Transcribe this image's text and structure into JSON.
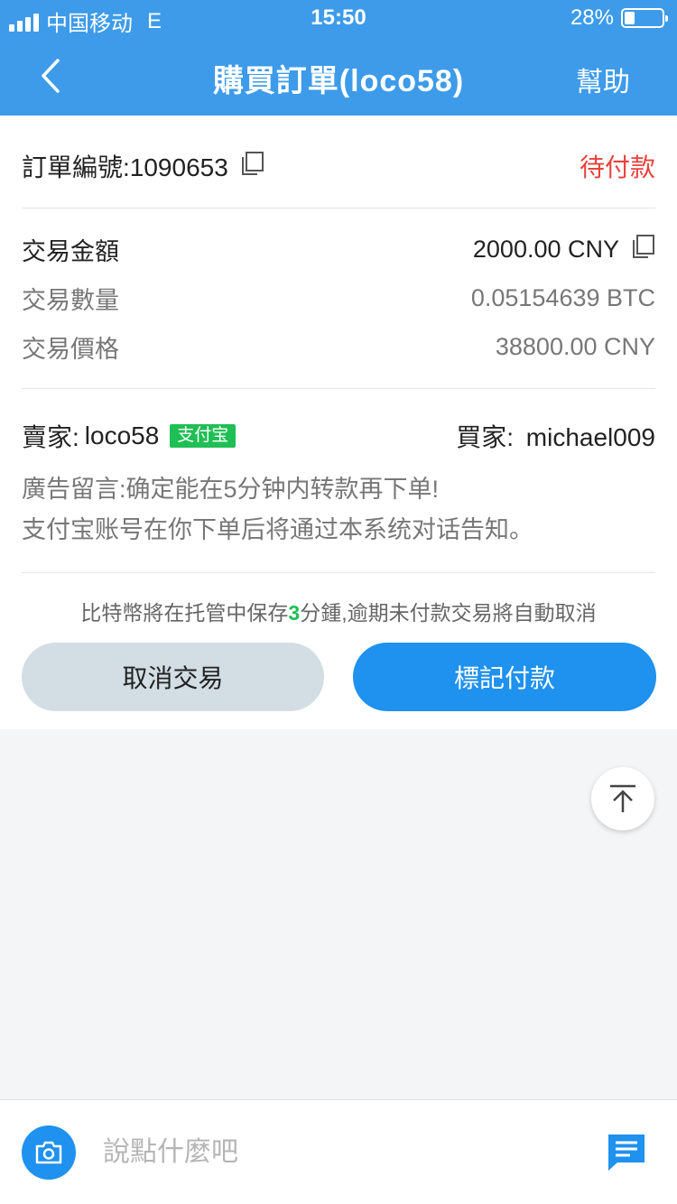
{
  "status_bar": {
    "carrier": "中国移动",
    "network": "E",
    "time": "15:50",
    "battery_text": "28%",
    "battery_level": 0.28
  },
  "nav": {
    "back_icon": "chevron-left-icon",
    "title": "購買訂單(loco58)",
    "help_label": "幫助"
  },
  "order": {
    "number_label": "訂單編號:1090653",
    "status": "待付款",
    "amount_label": "交易金額",
    "amount_value": "2000.00 CNY",
    "quantity_label": "交易數量",
    "quantity_value": "0.05154639 BTC",
    "price_label": "交易價格",
    "price_value": "38800.00 CNY",
    "seller_label": "賣家:",
    "seller_name": "loco58",
    "seller_payment_tag": "支付宝",
    "buyer_label": "買家:",
    "buyer_name": "michael009",
    "ad_message_line1": "廣告留言:确定能在5分钟内转款再下单!",
    "ad_message_line2": "支付宝账号在你下单后将通过本系统对话告知。"
  },
  "notice": {
    "prefix": "比特幣將在托管中保存",
    "minutes": "3",
    "suffix": "分鍾,逾期未付款交易將自動取消"
  },
  "actions": {
    "cancel_label": "取消交易",
    "mark_paid_label": "標記付款"
  },
  "input_bar": {
    "placeholder": "說點什麼吧",
    "camera_icon": "camera-icon",
    "chat_icon": "chat-icon"
  },
  "colors": {
    "brand_blue": "#3d9be9",
    "button_blue": "#1f91ee",
    "status_red": "#e9413c",
    "alipay_green": "#1fbf55"
  }
}
